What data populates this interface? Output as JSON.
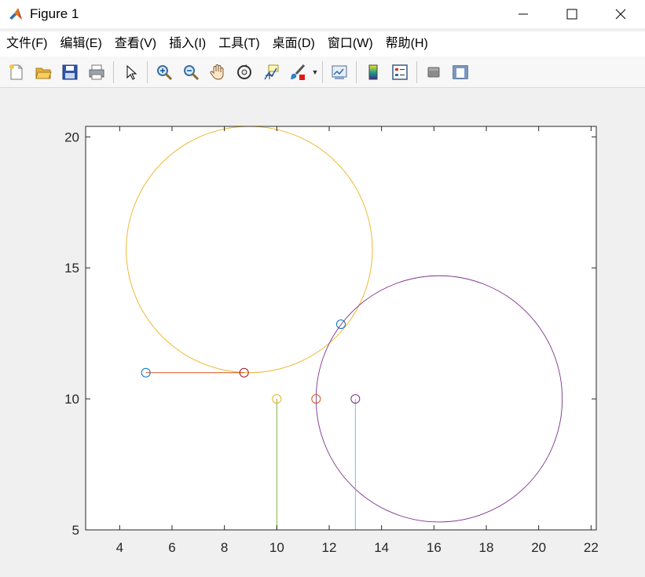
{
  "window": {
    "title": "Figure 1",
    "controls": {
      "minimize": "—",
      "maximize": "☐",
      "close": "✕"
    }
  },
  "menu": {
    "items": [
      {
        "name": "menu-file",
        "label": "文件(F)"
      },
      {
        "name": "menu-edit",
        "label": "编辑(E)"
      },
      {
        "name": "menu-view",
        "label": "查看(V)"
      },
      {
        "name": "menu-insert",
        "label": "插入(I)"
      },
      {
        "name": "menu-tools",
        "label": "工具(T)"
      },
      {
        "name": "menu-desktop",
        "label": "桌面(D)"
      },
      {
        "name": "menu-window",
        "label": "窗口(W)"
      },
      {
        "name": "menu-help",
        "label": "帮助(H)"
      }
    ]
  },
  "toolbar": {
    "icons": [
      "new-figure-icon",
      "open-file-icon",
      "save-icon",
      "print-icon",
      "pointer-icon",
      "zoom-in-icon",
      "zoom-out-icon",
      "pan-hand-icon",
      "rotate-3d-icon",
      "data-cursor-icon",
      "brush-icon",
      "link-plot-icon",
      "colorbar-icon",
      "legend-icon",
      "hide-plot-tools-icon",
      "show-plot-tools-icon"
    ]
  },
  "colors": {
    "blue": "#0072BD",
    "orange": "#D95319",
    "yellow": "#EDB120",
    "purple": "#7E2F8E",
    "green": "#77AC30",
    "cyan": "#4DBEEE",
    "darkred": "#A2142F"
  },
  "chart_data": {
    "type": "line",
    "title": "",
    "xlabel": "",
    "ylabel": "",
    "xlim": [
      2.7,
      22.2
    ],
    "ylim": [
      5,
      20.4
    ],
    "xticks": [
      4,
      6,
      8,
      10,
      12,
      14,
      16,
      18,
      20,
      22
    ],
    "yticks": [
      5,
      10,
      15,
      20
    ],
    "grid": false,
    "legend": "none",
    "circles": [
      {
        "cx": 8.95,
        "cy": 15.7,
        "r": 4.7,
        "color": "#EDB120"
      },
      {
        "cx": 16.2,
        "cy": 10.0,
        "r": 4.7,
        "color": "#7E2F8E"
      }
    ],
    "segments": [
      {
        "x": [
          5,
          8.75
        ],
        "y": [
          11,
          11
        ],
        "color": "#D95319"
      },
      {
        "x": [
          10,
          10
        ],
        "y": [
          10,
          5
        ],
        "color": "#77AC30"
      },
      {
        "x": [
          13,
          13
        ],
        "y": [
          10,
          5
        ],
        "color": "#4DBEEE"
      }
    ],
    "markers": [
      {
        "x": 5,
        "y": 11,
        "color": "#0072BD"
      },
      {
        "x": 8.75,
        "y": 11,
        "color": "#A2142F"
      },
      {
        "x": 12.45,
        "y": 12.85,
        "color": "#0072BD"
      },
      {
        "x": 10,
        "y": 10,
        "color": "#EDB120"
      },
      {
        "x": 11.5,
        "y": 10,
        "color": "#D95319"
      },
      {
        "x": 13,
        "y": 10,
        "color": "#7E2F8E"
      }
    ]
  }
}
